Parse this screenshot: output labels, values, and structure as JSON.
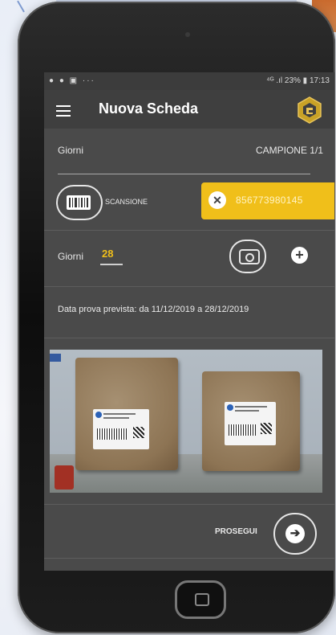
{
  "status_bar": {
    "left_icons": "● ● ▣  ···",
    "right_text": "⁴ᴳ .ıl 23% ▮ 17:13"
  },
  "app_bar": {
    "title": "Nuova Scheda"
  },
  "sample_row": {
    "label": "Giorni",
    "sample_counter": "CAMPIONE 1/1"
  },
  "scan": {
    "label": "SCANSIONE",
    "scanned_code": "856773980145"
  },
  "days": {
    "label": "Giorni",
    "value": "28"
  },
  "test_date": {
    "text": "Data prova prevista: da 11/12/2019 a 28/12/2019"
  },
  "footer": {
    "continue_label": "PROSEGUI"
  },
  "colors": {
    "accent": "#f0bf1a",
    "screen_bg": "#4a4a4a",
    "app_bar_bg": "#3f3f3f"
  }
}
